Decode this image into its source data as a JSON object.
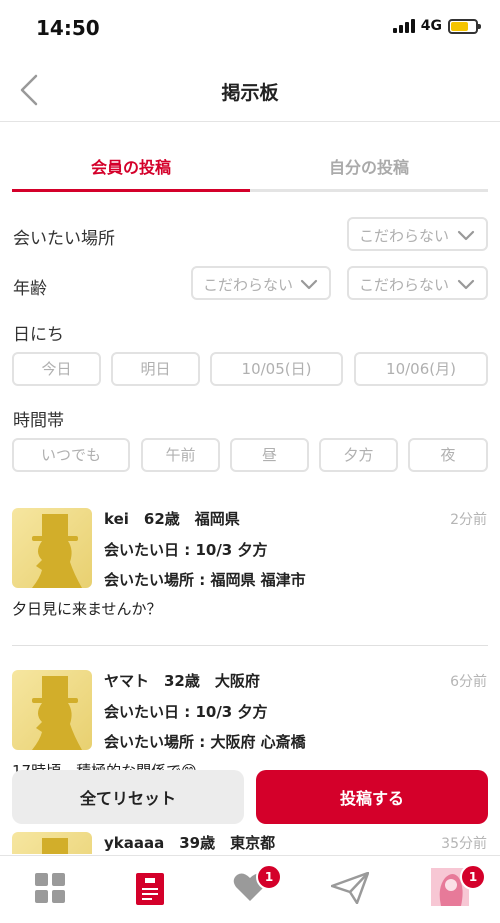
{
  "status": {
    "time": "14:50",
    "network": "4G"
  },
  "nav": {
    "title": "掲示板"
  },
  "tabs": [
    {
      "label": "会員の投稿",
      "active": true
    },
    {
      "label": "自分の投稿",
      "active": false
    }
  ],
  "filters": {
    "place": {
      "label": "会いたい場所",
      "value": "こだわらない"
    },
    "age": {
      "label": "年齢",
      "min": "こだわらない",
      "max": "こだわらない"
    },
    "date": {
      "label": "日にち",
      "options": [
        "今日",
        "明日",
        "10/05(日)",
        "10/06(月)"
      ]
    },
    "time": {
      "label": "時間帯",
      "options": [
        "いつでも",
        "午前",
        "昼",
        "夕方",
        "夜"
      ]
    }
  },
  "posts": [
    {
      "header": "kei　62歳　福岡県",
      "time": "2分前",
      "meet_day": "会いたい日 : 10/3 夕方",
      "meet_place": "会いたい場所 : 福岡県 福津市",
      "message": "夕日見に来ませんか？"
    },
    {
      "header": "ヤマト　32歳　大阪府",
      "time": "6分前",
      "meet_day": "会いたい日 : 10/3 夕方",
      "meet_place": "会いたい場所 : 大阪府 心斎橋",
      "message": "17時頃、積極的な関係で😊"
    },
    {
      "header": "ykaaaa　39歳　東京都",
      "time": "35分前"
    }
  ],
  "actions": {
    "reset": "全てリセット",
    "post": "投稿する"
  },
  "tabbar": {
    "items": [
      "home",
      "board",
      "likes",
      "messages",
      "profile"
    ],
    "likes_badge": "1",
    "profile_badge": "1"
  },
  "colors": {
    "accent": "#d4002a",
    "battery": "#f5c400"
  }
}
